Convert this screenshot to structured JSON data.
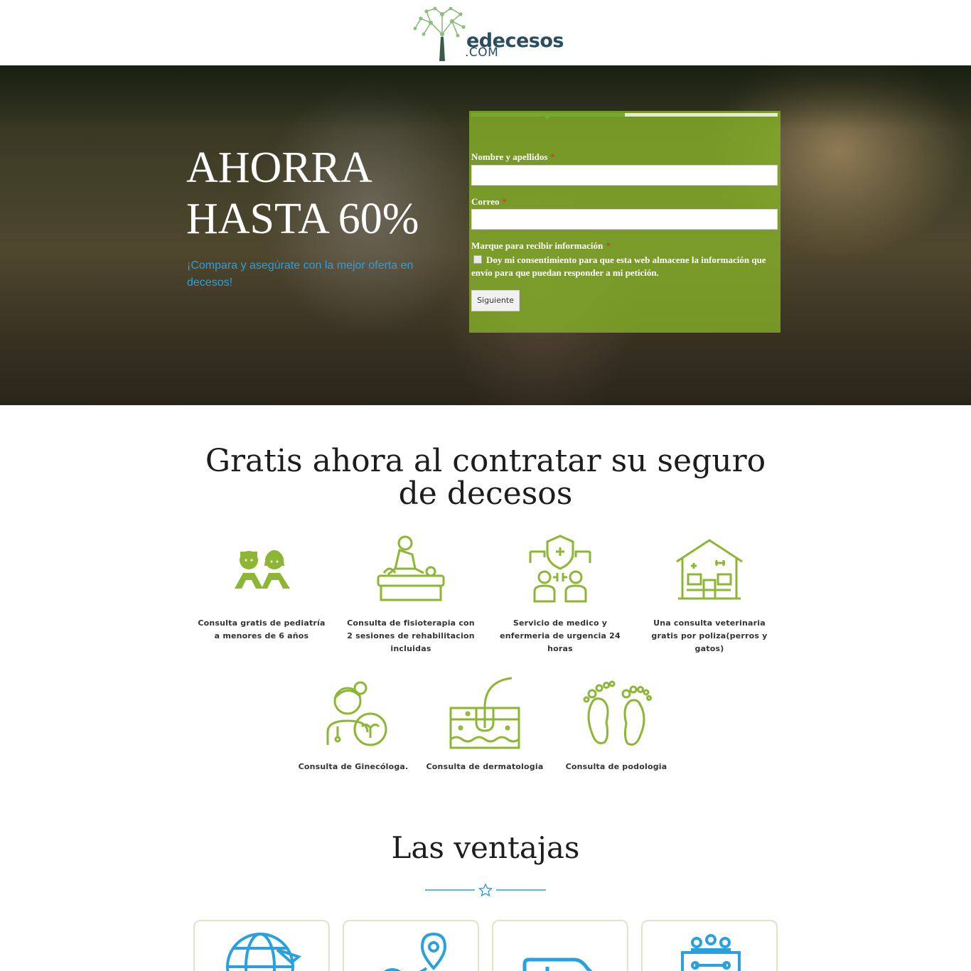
{
  "header": {
    "logo_text": "edecesos",
    "logo_sub": ".COM"
  },
  "hero": {
    "title_line1": "AHORRA",
    "title_line2": "HASTA 60%",
    "subtitle": "¡Compara y  asegúrate con la mejor oferta en decesos!"
  },
  "form": {
    "progress_percent": 50,
    "name_label": "Nombre y apellidos",
    "email_label": "Correo",
    "consent_heading": "Marque para recibir información",
    "consent_text": "Doy mi consentimiento para que esta web almacene la información que envío para que puedan responder a mi petición.",
    "required_mark": "*",
    "next_button": "Siguiente"
  },
  "gratis": {
    "title": "Gratis ahora al contratar su seguro de decesos",
    "services": [
      {
        "label": "Consulta gratis de pediatría a menores de 6 años",
        "icon": "children-icon"
      },
      {
        "label": "Consulta de fisioterapia con 2 sesiones de rehabilitacion incluidas",
        "icon": "physiotherapy-icon"
      },
      {
        "label": "Servicio de medico y enfermeria de urgencia 24 horas",
        "icon": "medical-team-icon"
      },
      {
        "label": "Una consulta veterinaria gratis por poliza(perros y gatos)",
        "icon": "veterinary-clinic-icon"
      },
      {
        "label": "Consulta de Ginecóloga.",
        "icon": "gynecologist-icon"
      },
      {
        "label": "Consulta de dermatologia",
        "icon": "skin-hair-follicle-icon"
      },
      {
        "label": "Consulta de podologia",
        "icon": "footprints-icon"
      }
    ]
  },
  "ventajas": {
    "title": "Las ventajas",
    "cards": [
      {
        "icon": "globe-plane-icon"
      },
      {
        "icon": "location-route-icon"
      },
      {
        "icon": "ambulance-icon"
      },
      {
        "icon": "coffin-flowers-icon"
      }
    ]
  },
  "colors": {
    "brand_green": "#8cb634",
    "brand_blue": "#2aa0dc",
    "logo_navy": "#2b4d5f",
    "form_overlay": "#87b428"
  }
}
